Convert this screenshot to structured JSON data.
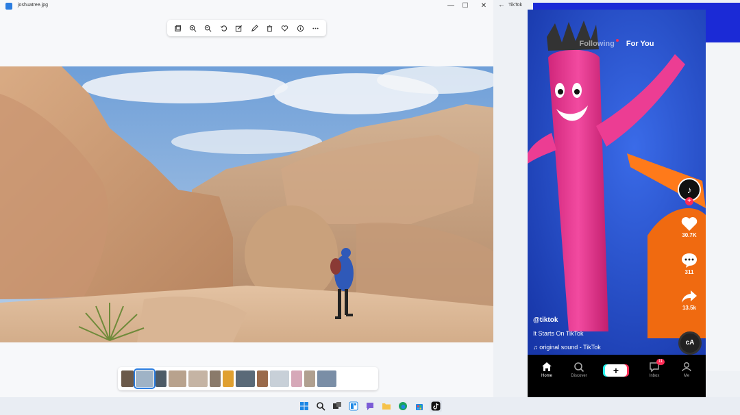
{
  "photos": {
    "title": "joshuatree.jpg",
    "window_controls": {
      "minimize": "—",
      "maximize": "☐",
      "close": "✕"
    },
    "toolbar_icons": [
      "gallery-icon",
      "zoom-in-icon",
      "zoom-out-icon",
      "rotate-icon",
      "edit-icon",
      "draw-icon",
      "delete-icon",
      "favorite-icon",
      "info-icon",
      "more-icon"
    ],
    "filmstrip_count": 13,
    "filmstrip_selected_index": 1
  },
  "tiktok": {
    "window_title": "TikTok",
    "back_glyph": "←",
    "tabs": {
      "following": "Following",
      "for_you": "For You"
    },
    "likes": "30.7K",
    "comments": "311",
    "shares": "13.5k",
    "username": "@tiktok",
    "description": "It Starts On TikTok",
    "sound": "original sound - TikTok",
    "nav": {
      "home": "Home",
      "discover": "Discover",
      "create": "+",
      "inbox": "Inbox",
      "inbox_badge": "11",
      "me": "Me"
    },
    "colors": {
      "accent": "#fe2c55",
      "cyan": "#25f4ee",
      "video_bg": "#1f4fd8"
    }
  },
  "taskbar": {
    "icons": [
      "start-icon",
      "search-icon",
      "task-view-icon",
      "widgets-icon",
      "chat-icon",
      "file-explorer-icon",
      "edge-icon",
      "store-icon",
      "tiktok-icon"
    ]
  }
}
